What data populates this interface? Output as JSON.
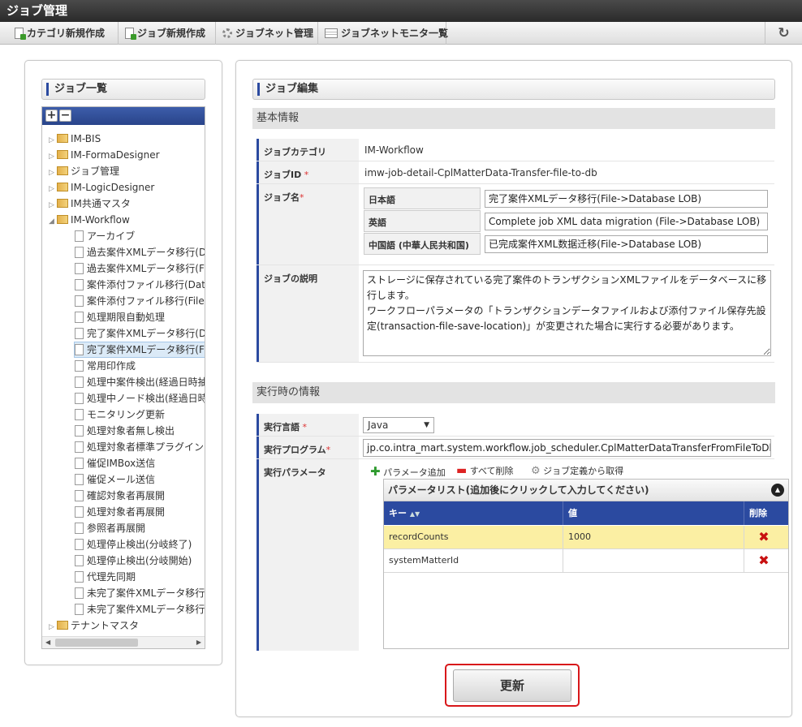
{
  "app": {
    "title": "ジョブ管理"
  },
  "toolbar": {
    "items": [
      {
        "label": "カテゴリ新規作成",
        "icon": "page-add-icon"
      },
      {
        "label": "ジョブ新規作成",
        "icon": "page-add-icon"
      },
      {
        "label": "ジョブネット管理",
        "icon": "gear-icon"
      },
      {
        "label": "ジョブネットモニタ一覧",
        "icon": "monitor-icon"
      }
    ],
    "refresh_icon": "refresh-icon",
    "refresh_glyph": "↻"
  },
  "left": {
    "title": "ジョブ一覧",
    "expand_glyph": "+",
    "collapse_glyph": "−",
    "tree": [
      {
        "label": "IM-BIS",
        "type": "folder",
        "level": 0,
        "expanded": false
      },
      {
        "label": "IM-FormaDesigner",
        "type": "folder",
        "level": 0,
        "expanded": false
      },
      {
        "label": "ジョブ管理",
        "type": "folder",
        "level": 0,
        "expanded": false
      },
      {
        "label": "IM-LogicDesigner",
        "type": "folder",
        "level": 0,
        "expanded": false
      },
      {
        "label": "IM共通マスタ",
        "type": "folder",
        "level": 0,
        "expanded": false
      },
      {
        "label": "IM-Workflow",
        "type": "folder",
        "level": 0,
        "expanded": true
      },
      {
        "label": "アーカイブ",
        "type": "file",
        "level": 1
      },
      {
        "label": "過去案件XMLデータ移行(D",
        "type": "file",
        "level": 1
      },
      {
        "label": "過去案件XMLデータ移行(F",
        "type": "file",
        "level": 1
      },
      {
        "label": "案件添付ファイル移行(Data",
        "type": "file",
        "level": 1
      },
      {
        "label": "案件添付ファイル移行(File-",
        "type": "file",
        "level": 1
      },
      {
        "label": "処理期限自動処理",
        "type": "file",
        "level": 1
      },
      {
        "label": "完了案件XMLデータ移行(D",
        "type": "file",
        "level": 1
      },
      {
        "label": "完了案件XMLデータ移行(F",
        "type": "file",
        "level": 1,
        "selected": true
      },
      {
        "label": "常用印作成",
        "type": "file",
        "level": 1
      },
      {
        "label": "処理中案件検出(経過日時抽",
        "type": "file",
        "level": 1
      },
      {
        "label": "処理中ノード検出(経過日時",
        "type": "file",
        "level": 1
      },
      {
        "label": "モニタリング更新",
        "type": "file",
        "level": 1
      },
      {
        "label": "処理対象者無し検出",
        "type": "file",
        "level": 1
      },
      {
        "label": "処理対象者標準プラグイン(",
        "type": "file",
        "level": 1
      },
      {
        "label": "催促IMBox送信",
        "type": "file",
        "level": 1
      },
      {
        "label": "催促メール送信",
        "type": "file",
        "level": 1
      },
      {
        "label": "確認対象者再展開",
        "type": "file",
        "level": 1
      },
      {
        "label": "処理対象者再展開",
        "type": "file",
        "level": 1
      },
      {
        "label": "参照者再展開",
        "type": "file",
        "level": 1
      },
      {
        "label": "処理停止検出(分岐終了)",
        "type": "file",
        "level": 1
      },
      {
        "label": "処理停止検出(分岐開始)",
        "type": "file",
        "level": 1
      },
      {
        "label": "代理先同期",
        "type": "file",
        "level": 1
      },
      {
        "label": "未完了案件XMLデータ移行",
        "type": "file",
        "level": 1
      },
      {
        "label": "未完了案件XMLデータ移行",
        "type": "file",
        "level": 1
      },
      {
        "label": "テナントマスタ",
        "type": "folder",
        "level": 0,
        "expanded": false
      }
    ]
  },
  "right": {
    "title": "ジョブ編集",
    "basic": {
      "heading": "基本情報",
      "category_label": "ジョブカテゴリ",
      "category_value": "IM-Workflow",
      "id_label": "ジョブID",
      "id_value": "imw-job-detail-CplMatterData-Transfer-file-to-db",
      "name_label": "ジョブ名",
      "names": [
        {
          "lang": "日本語",
          "value": "完了案件XMLデータ移行(File->Database LOB)"
        },
        {
          "lang": "英語",
          "value": "Complete job XML data migration (File->Database LOB)"
        },
        {
          "lang": "中国語 (中華人民共和国)",
          "value": "已完成案件XML数据迁移(File->Database LOB)"
        }
      ],
      "desc_label": "ジョブの説明",
      "desc_value": "ストレージに保存されている完了案件のトランザクションXMLファイルをデータベースに移行します。\nワークフローパラメータの「トランザクションデータファイルおよび添付ファイル保存先設定(transaction-file-save-location)」が変更された場合に実行する必要があります。"
    },
    "runtime": {
      "heading": "実行時の情報",
      "lang_label": "実行言語",
      "lang_value": "Java",
      "program_label": "実行プログラム",
      "program_value": "jp.co.intra_mart.system.workflow.job_scheduler.CplMatterDataTransferFromFileToDb",
      "params_label": "実行パラメータ",
      "actions": [
        {
          "label": "パラメータ追加",
          "icon": "plus-icon"
        },
        {
          "label": "すべて削除",
          "icon": "minus-icon"
        },
        {
          "label": "ジョブ定義から取得",
          "icon": "gear-icon"
        }
      ],
      "param_caption": "パラメータリスト(追加後にクリックして入力してください)",
      "param_columns": [
        "キー",
        "値",
        "削除"
      ],
      "params": [
        {
          "key": "recordCounts",
          "value": "1000",
          "highlight": true
        },
        {
          "key": "systemMatterId",
          "value": "",
          "highlight": false
        }
      ]
    },
    "update_label": "更新"
  },
  "colors": {
    "accent": "#2b4aa0",
    "highlight_row": "#fbefa3",
    "update_outline": "#d8171a",
    "delete": "#c81010"
  }
}
